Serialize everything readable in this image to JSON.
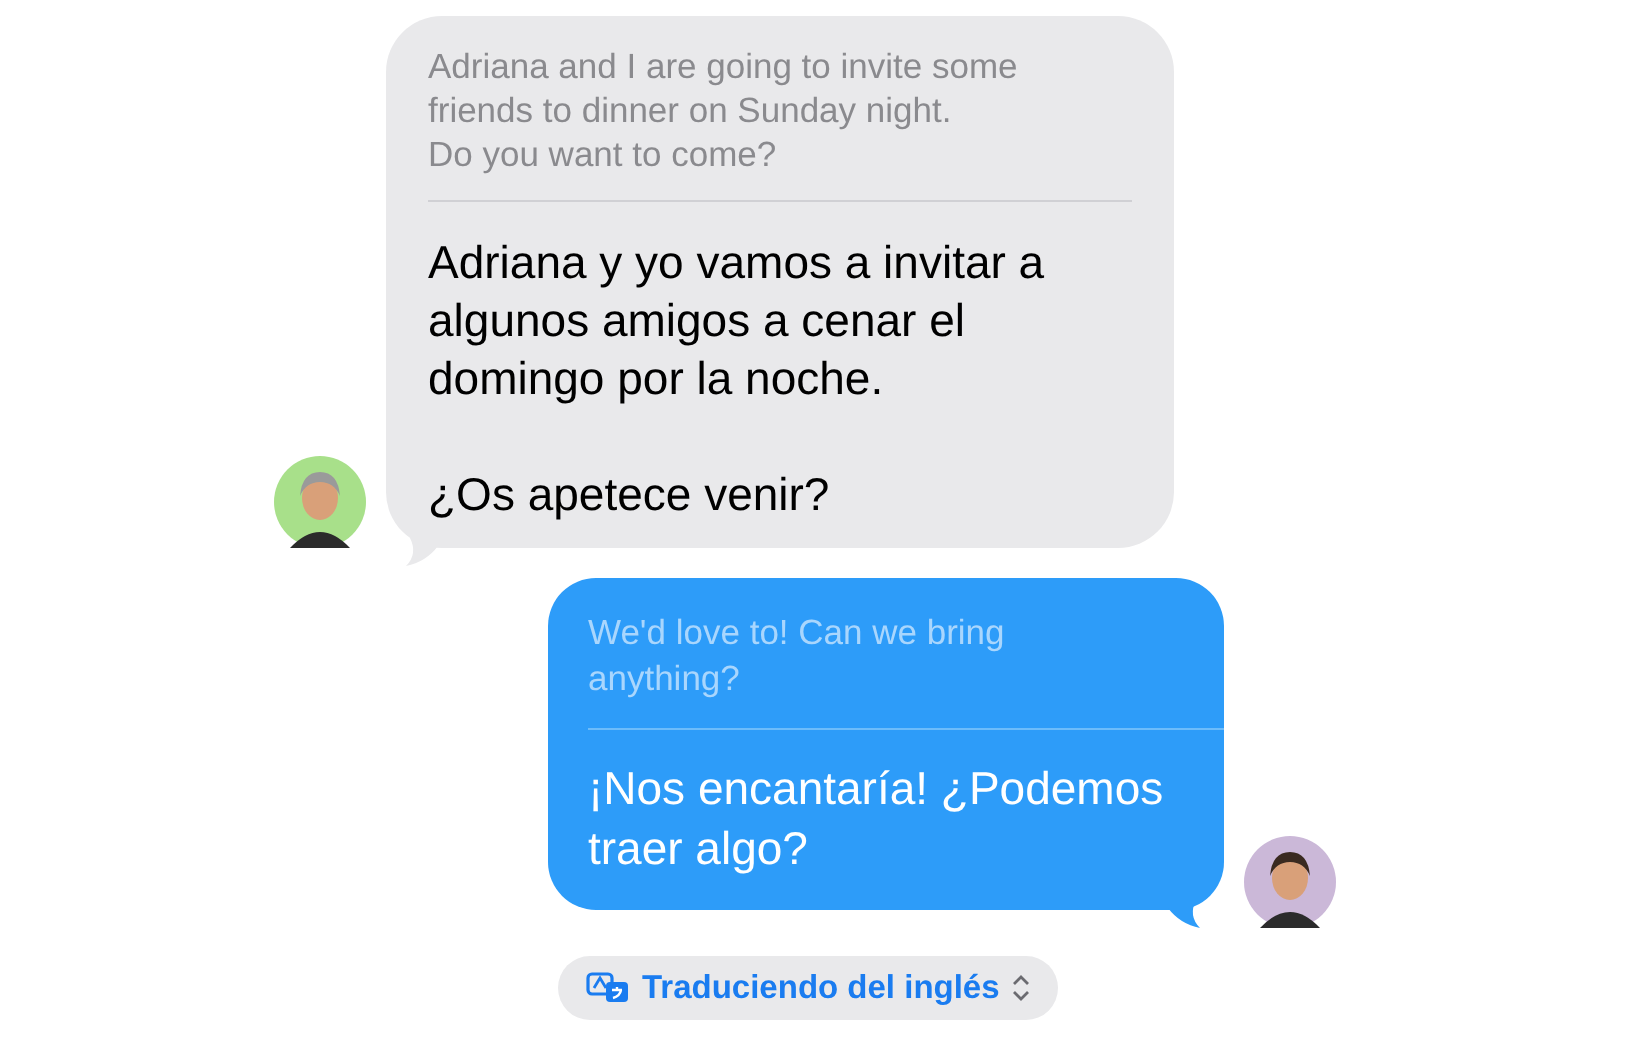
{
  "messages": [
    {
      "kind": "incoming",
      "original": "Adriana and I are going to invite some friends to dinner on Sunday night.\nDo you want to come?",
      "translation": "Adriana y yo vamos a invitar a algunos amigos a cenar el domingo por la noche.\n\n¿Os apetece venir?"
    },
    {
      "kind": "outgoing",
      "original": "We'd love to! Can we bring anything?",
      "translation": "¡Nos encantaría! ¿Podemos traer algo?"
    }
  ],
  "translation_status": {
    "label": "Traduciendo del inglés"
  }
}
